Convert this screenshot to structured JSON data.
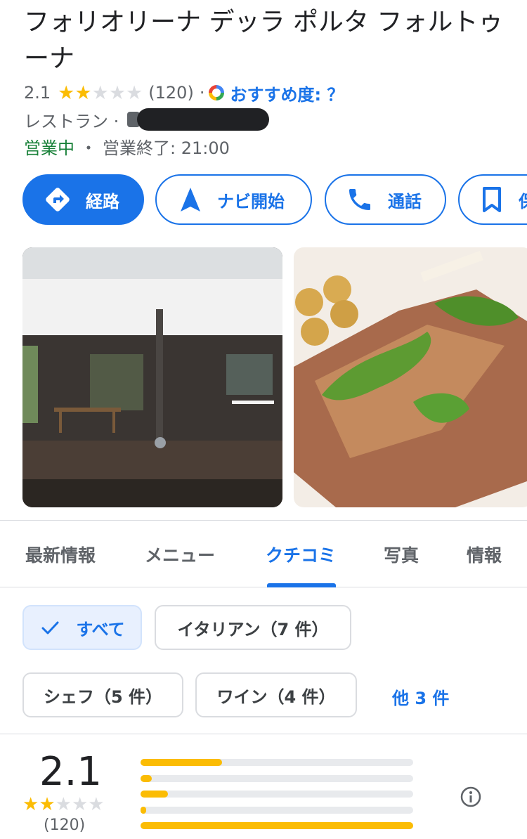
{
  "place": {
    "title": "フォリオリーナ デッラ ポルタ フォルトゥーナ",
    "rating": "2.1",
    "stars_filled": 2,
    "stars_total": 5,
    "review_count": "(120)",
    "separator": "·",
    "recommendation": "おすすめ度: ？",
    "category": "レストラン ·",
    "status": "営業中",
    "hours_sep": "・",
    "hours": "営業終了: 21:00"
  },
  "actions": [
    {
      "label": "経路",
      "icon": "directions-icon"
    },
    {
      "label": "ナビ開始",
      "icon": "navigation-arrow-icon"
    },
    {
      "label": "通話",
      "icon": "phone-icon"
    },
    {
      "label": "保",
      "icon": "bookmark-icon"
    }
  ],
  "tabs": [
    "最新情報",
    "メニュー",
    "クチコミ",
    "写真",
    "情報"
  ],
  "active_tab": "クチコミ",
  "filters": {
    "chips": [
      "すべて",
      "イタリアン（7 件）",
      "シェフ（5 件）",
      "ワイン（4 件）"
    ],
    "selected": "すべて",
    "more": "他 3 件"
  },
  "summary": {
    "rating": "2.1",
    "count": "(120)",
    "distribution": [
      {
        "stars": 5,
        "fraction": 0.3
      },
      {
        "stars": 4,
        "fraction": 0.04
      },
      {
        "stars": 3,
        "fraction": 0.1
      },
      {
        "stars": 2,
        "fraction": 0.02
      },
      {
        "stars": 1,
        "fraction": 1.0
      }
    ]
  },
  "colors": {
    "accent": "#1a73e8",
    "star": "#fbbc04",
    "open": "#188038"
  }
}
